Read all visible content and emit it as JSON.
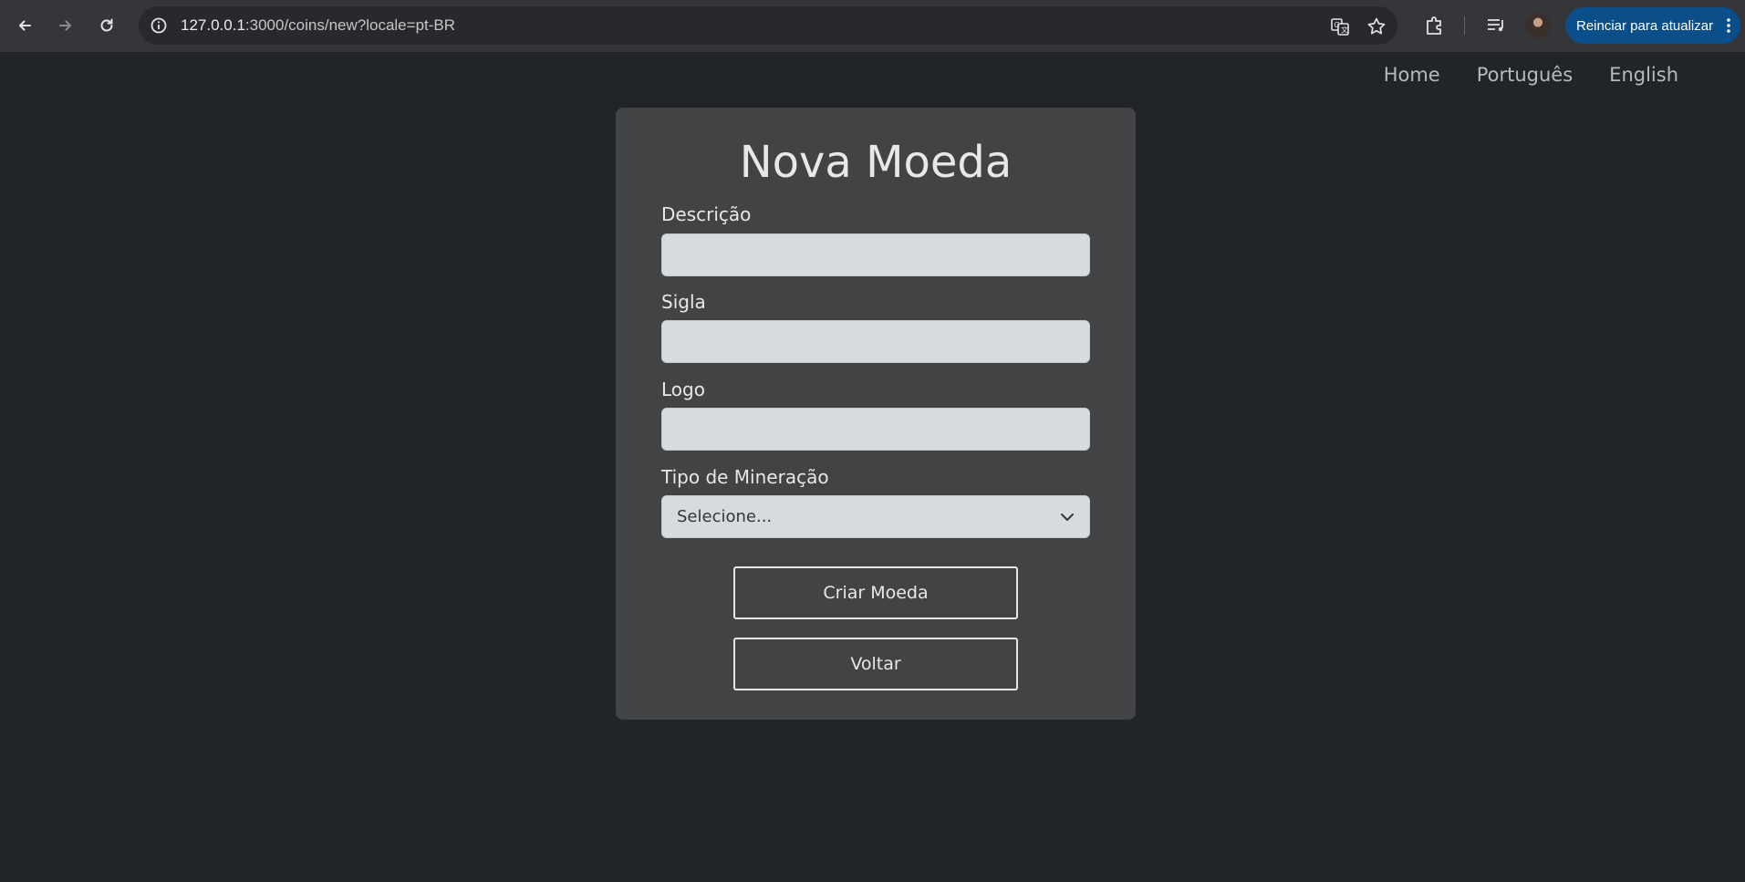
{
  "browser": {
    "url_host": "127.0.0.1",
    "url_rest": ":3000/coins/new?locale=pt-BR",
    "update_button": "Reinciar para atualizar",
    "icons": [
      "back-icon",
      "forward-icon",
      "reload-icon",
      "site-info-icon",
      "translate-icon",
      "bookmark-star-icon",
      "extensions-icon",
      "media-control-icon",
      "profile-avatar",
      "more-menu-icon"
    ]
  },
  "nav": {
    "home": "Home",
    "portuguese": "Português",
    "english": "English"
  },
  "form": {
    "title": "Nova Moeda",
    "description_label": "Descrição",
    "symbol_label": "Sigla",
    "logo_label": "Logo",
    "mining_label": "Tipo de Mineração",
    "mining_selected": "Selecione...",
    "submit_label": "Criar Moeda",
    "back_label": "Voltar"
  },
  "colors": {
    "page_bg": "#212429",
    "card_bg": "#424345",
    "input_bg": "#d8dbdd",
    "update_button_bg": "#0a4f8a"
  }
}
